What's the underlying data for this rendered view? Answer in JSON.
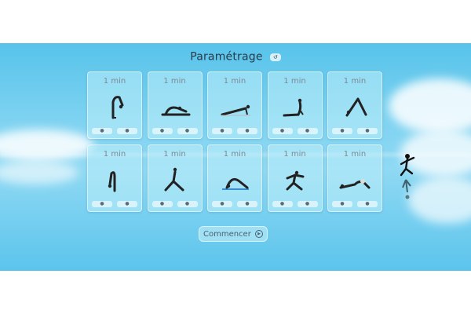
{
  "header": {
    "title": "Paramétrage",
    "reset_icon": "reset-icon"
  },
  "cards": [
    {
      "time": "1 min",
      "pose": "standing-forward-fold"
    },
    {
      "time": "1 min",
      "pose": "seated-forward-bend"
    },
    {
      "time": "1 min",
      "pose": "plank"
    },
    {
      "time": "1 min",
      "pose": "cobra"
    },
    {
      "time": "1 min",
      "pose": "downward-dog"
    },
    {
      "time": "1 min",
      "pose": "ragdoll-fold"
    },
    {
      "time": "1 min",
      "pose": "warrior-lunge"
    },
    {
      "time": "1 min",
      "pose": "plow"
    },
    {
      "time": "1 min",
      "pose": "lunge-twist"
    },
    {
      "time": "1 min",
      "pose": "reclined-stretch"
    }
  ],
  "card_controls": {
    "minus_icon": "minus-icon",
    "plus_icon": "plus-icon"
  },
  "start": {
    "label": "Commencer",
    "icon": "play-icon"
  },
  "colors": {
    "sky": "#57c3ea",
    "card": "#c3eefa",
    "text": "#2a3a4a"
  }
}
